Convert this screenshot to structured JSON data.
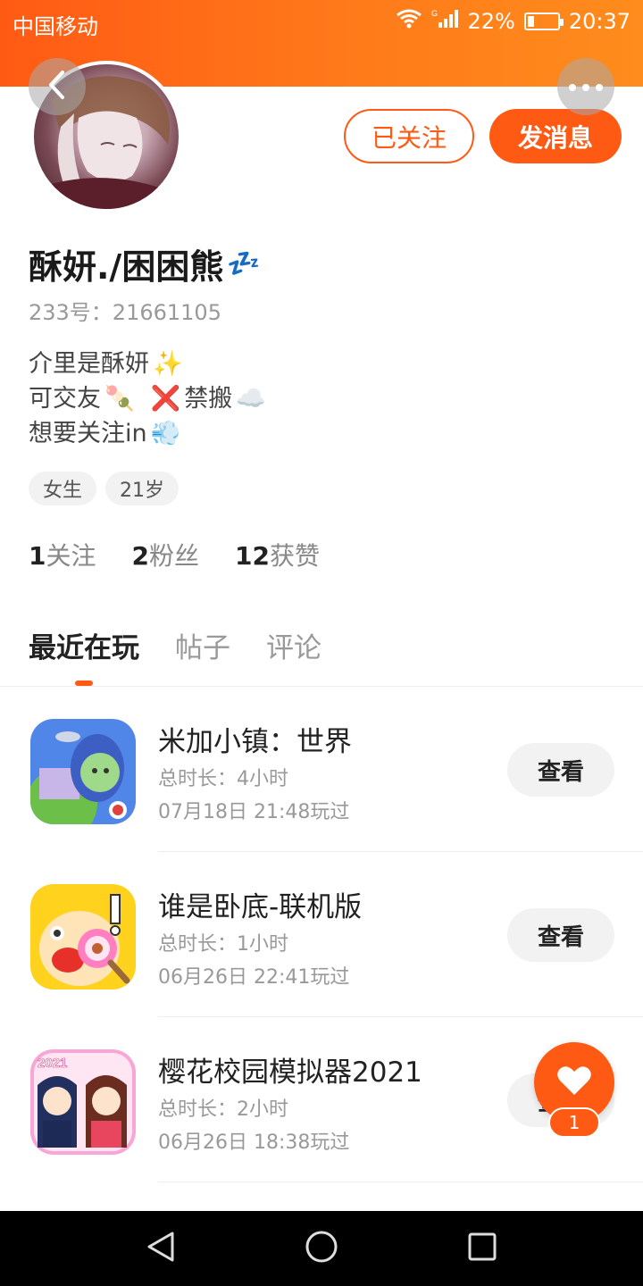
{
  "status_bar": {
    "carrier": "中国移动",
    "network": "G",
    "battery": "22%",
    "battery_level": 0.22,
    "time": "20:37"
  },
  "profile": {
    "name": "酥妍./困困熊",
    "name_emoji": "💤",
    "id_text": "233号：21661105",
    "bio": [
      {
        "text": "介里是酥妍",
        "emoji_after": "✨"
      },
      {
        "text": "可交友",
        "emoji_after": "🍡",
        "extra_icon": "❌",
        "extra_text": "禁搬",
        "extra_emoji": "☁️"
      },
      {
        "text": "想要关注in",
        "emoji_after": "💨"
      }
    ],
    "tags": [
      "女生",
      "21岁"
    ],
    "stats": [
      {
        "num": "1",
        "label": "关注"
      },
      {
        "num": "2",
        "label": "粉丝"
      },
      {
        "num": "12",
        "label": "获赞"
      }
    ]
  },
  "actions": {
    "followed_label": "已关注",
    "message_label": "发消息"
  },
  "tabs": [
    {
      "label": "最近在玩",
      "active": true
    },
    {
      "label": "帖子",
      "active": false
    },
    {
      "label": "评论",
      "active": false
    }
  ],
  "games": [
    {
      "title": "米加小镇：世界",
      "duration": "总时长：4小时",
      "last_played": "07月18日 21:48玩过",
      "button": "查看"
    },
    {
      "title": "谁是卧底-联机版",
      "duration": "总时长：1小时",
      "last_played": "06月26日 22:41玩过",
      "button": "查看"
    },
    {
      "title": "樱花校园模拟器2021",
      "duration": "总时长：2小时",
      "last_played": "06月26日 18:38玩过",
      "button": "查看",
      "icon_badge": "2021"
    }
  ],
  "like": {
    "count": "1"
  },
  "colors": {
    "accent": "#ff5a14",
    "header_gradient_end": "#ff8c1c",
    "muted": "#999999"
  }
}
